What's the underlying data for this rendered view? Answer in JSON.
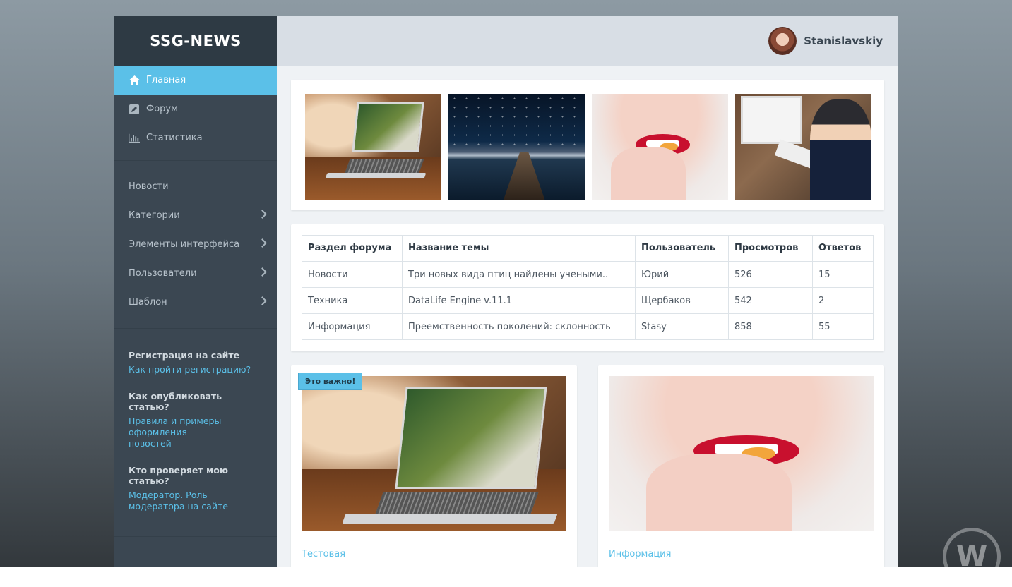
{
  "brand": "SSG-NEWS",
  "user": {
    "name": "Stanislavskiy",
    "avatar": "user-avatar-photo"
  },
  "sidebar": {
    "main_nav": [
      {
        "label": "Главная",
        "icon": "home-icon",
        "active": true
      },
      {
        "label": "Форум",
        "icon": "edit-square-icon",
        "active": false
      },
      {
        "label": "Статистика",
        "icon": "bar-chart-icon",
        "active": false
      }
    ],
    "sections": [
      {
        "label": "Новости",
        "has_submenu": false
      },
      {
        "label": "Категории",
        "has_submenu": true
      },
      {
        "label": "Элементы интерфейса",
        "has_submenu": true
      },
      {
        "label": "Пользователи",
        "has_submenu": true
      },
      {
        "label": "Шаблон",
        "has_submenu": true
      }
    ],
    "help": [
      {
        "title": "Регистрация на сайте",
        "link": "Как пройти регистрацию?"
      },
      {
        "title": "Как опубликовать статью?",
        "link": "Правила и примеры оформления новостей"
      },
      {
        "title": "Кто проверяет мою статью?",
        "link": "Модератор. Роль модератора на сайте"
      }
    ]
  },
  "gallery": [
    "laptop-photo",
    "night-lake-pier-photo",
    "woman-lips-pill-photo",
    "office-businessman-photo"
  ],
  "forum_table": {
    "headers": [
      "Раздел форума",
      "Название темы",
      "Пользователь",
      "Просмотров",
      "Ответов"
    ],
    "rows": [
      [
        "Новости",
        "Три новых вида птиц найдены учеными..",
        "Юрий",
        "526",
        "15"
      ],
      [
        "Техника",
        "DataLife Engine v.11.1",
        "Щербаков",
        "542",
        "2"
      ],
      [
        "Информация",
        "Преемственность поколений: склонность",
        "Stasy",
        "858",
        "55"
      ]
    ]
  },
  "posts": [
    {
      "badge": "Это важно!",
      "category": "Тестовая",
      "image": "laptop-photo"
    },
    {
      "badge": "",
      "category": "Информация",
      "image": "woman-lips-pill-photo"
    }
  ],
  "colors": {
    "accent": "#5bc0e8",
    "sidebar": "#3b4752",
    "brand_bg": "#2e3a44",
    "header": "#d8dee5",
    "content_bg": "#eff2f5"
  }
}
